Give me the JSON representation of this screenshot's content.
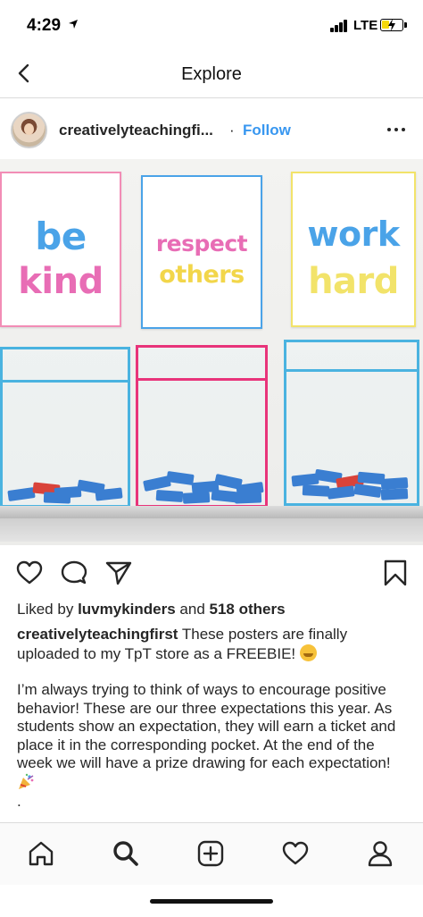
{
  "status_bar": {
    "time": "4:29",
    "network": "LTE",
    "battery_level": 0.4,
    "battery_color": "#f5d90a"
  },
  "nav": {
    "title": "Explore",
    "back_icon": "chevron-left-icon"
  },
  "post": {
    "username": "creativelyteachingfi...",
    "separator": "·",
    "follow_label": "Follow",
    "more_icon": "more-horizontal-icon",
    "photo": {
      "posters": [
        {
          "line1": "be",
          "line2": "kind",
          "border_color": "#f28db6",
          "line1_color": "#4aa3e8",
          "line2_color": "#e86db5"
        },
        {
          "line1": "respect",
          "line2": "others",
          "border_color": "#4aa3e8",
          "line1_color": "#e86db5",
          "line2_color": "#f2d64a"
        },
        {
          "line1": "work",
          "line2": "hard",
          "border_color": "#f2e36a",
          "line1_color": "#4aa3e8",
          "line2_color": "#f2e36a"
        }
      ],
      "pocket_colors": [
        "#4ab3e0",
        "#e8347a",
        "#4ab3e0"
      ]
    },
    "actions": {
      "like_icon": "heart-icon",
      "comment_icon": "comment-icon",
      "share_icon": "send-icon",
      "save_icon": "bookmark-icon"
    },
    "likes": {
      "prefix": "Liked by",
      "user": "luvmykinders",
      "connector": "and",
      "others": "518 others"
    },
    "caption": {
      "username": "creativelyteachingfirst",
      "line1": " These posters are finally uploaded to my TpT store as a FREEBIE! ",
      "paragraph2": "I’m always trying to think of ways to encourage positive behavior! These are our three expectations this year. As students show an expectation, they will earn a ticket and place it in the corresponding pocket. At the end of the week we will have a prize drawing for each expectation! ",
      "trailing": "."
    }
  },
  "tab_bar": {
    "items": [
      {
        "name": "home-icon"
      },
      {
        "name": "search-icon"
      },
      {
        "name": "add-post-icon"
      },
      {
        "name": "activity-heart-icon"
      },
      {
        "name": "profile-icon"
      }
    ]
  }
}
